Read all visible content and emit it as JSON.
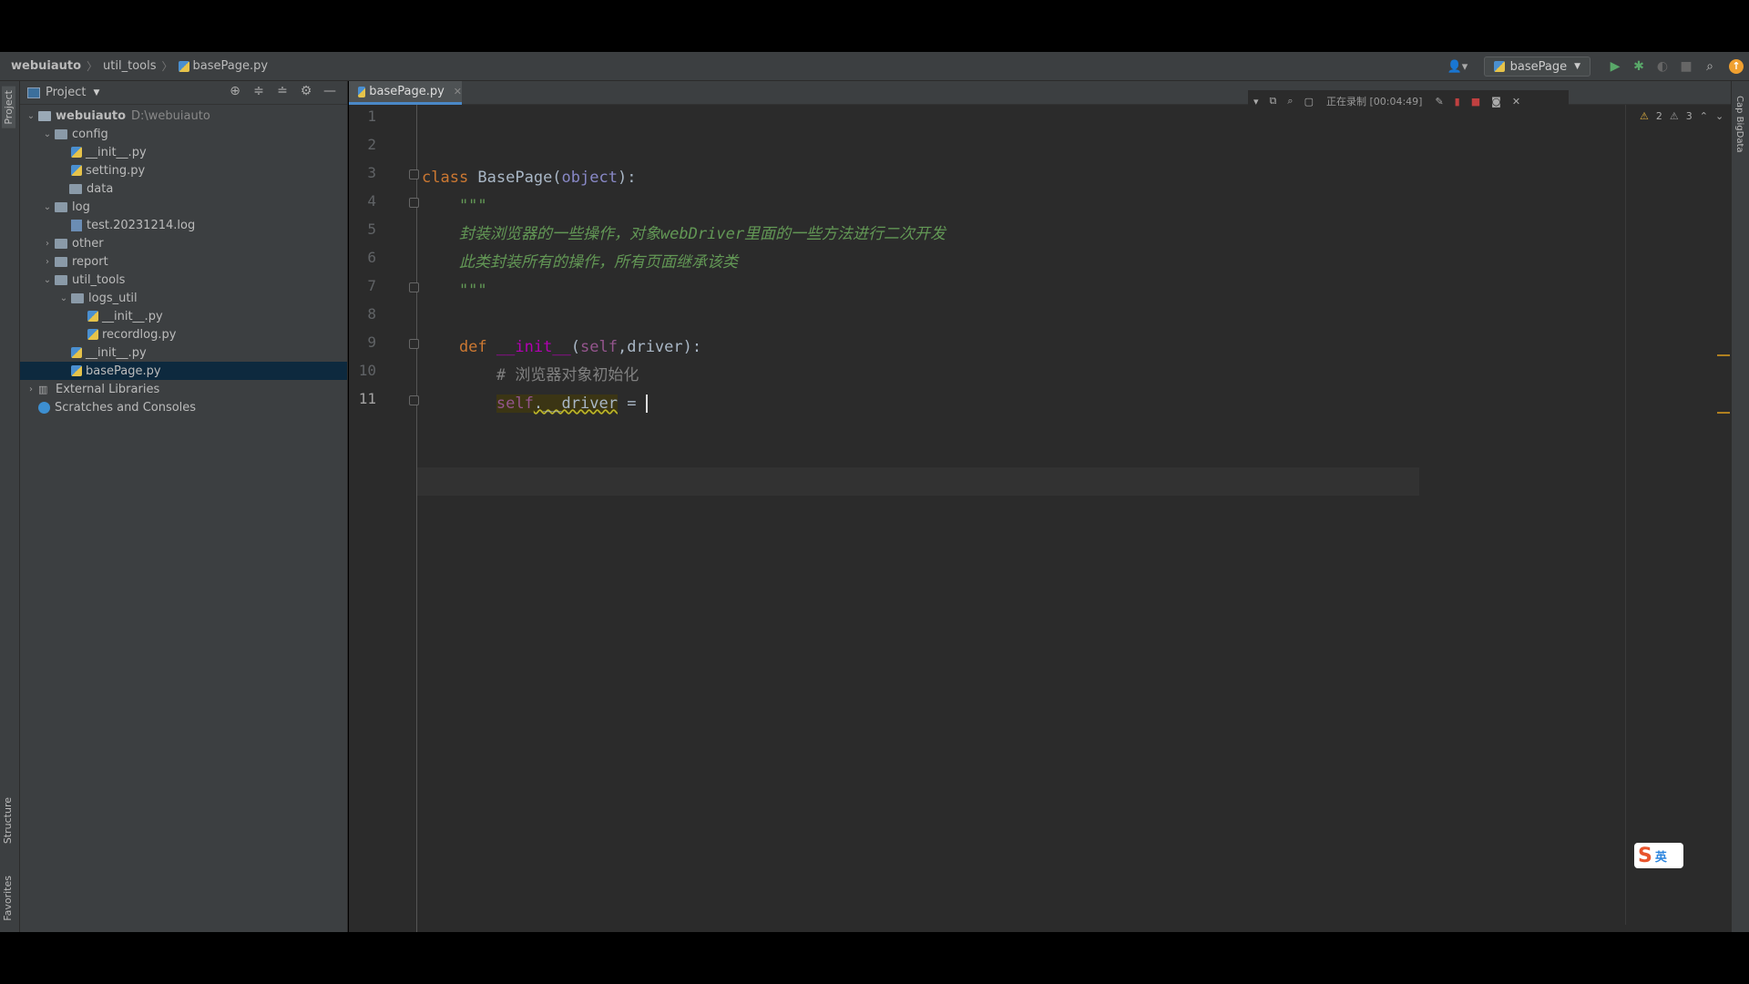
{
  "breadcrumb": {
    "project": "webuiauto",
    "folder": "util_tools",
    "file": "basePage.py"
  },
  "run_config": {
    "label": "basePage"
  },
  "project_panel": {
    "title": "Project",
    "tree": [
      {
        "label": "webuiauto",
        "path": "D:\\webuiauto",
        "kind": "root",
        "expanded": true
      },
      {
        "label": "config",
        "kind": "folder",
        "expanded": true
      },
      {
        "label": "__init__.py",
        "kind": "py"
      },
      {
        "label": "setting.py",
        "kind": "py"
      },
      {
        "label": "data",
        "kind": "folder"
      },
      {
        "label": "log",
        "kind": "folder",
        "expanded": true
      },
      {
        "label": "test.20231214.log",
        "kind": "log"
      },
      {
        "label": "other",
        "kind": "folder",
        "collapsed": true
      },
      {
        "label": "report",
        "kind": "folder",
        "collapsed": true
      },
      {
        "label": "util_tools",
        "kind": "folder",
        "expanded": true
      },
      {
        "label": "logs_util",
        "kind": "folder",
        "expanded": true
      },
      {
        "label": "__init__.py",
        "kind": "py"
      },
      {
        "label": "recordlog.py",
        "kind": "py"
      },
      {
        "label": "__init__.py",
        "kind": "py"
      },
      {
        "label": "basePage.py",
        "kind": "py",
        "selected": true
      },
      {
        "label": "External Libraries",
        "kind": "lib",
        "collapsed": true
      },
      {
        "label": "Scratches and Consoles",
        "kind": "scratch"
      }
    ]
  },
  "editor": {
    "tab_label": "basePage.py",
    "recording_text": "正在录制 [00:04:49]",
    "warnings": {
      "yellow": "2",
      "grey": "3"
    },
    "line_numbers": [
      "1",
      "2",
      "3",
      "4",
      "5",
      "6",
      "7",
      "8",
      "9",
      "10",
      "11"
    ],
    "code": {
      "l3_kw": "class",
      "l3_name": " BasePage(",
      "l3_obj": "object",
      "l3_end": "):",
      "l4": "    \"\"\"",
      "l5": "    封装浏览器的一些操作，对象webDriver里面的一些方法进行二次开发",
      "l6": "    此类封装所有的操作，所有页面继承该类",
      "l7": "    \"\"\"",
      "l9_kw": "    def",
      "l9_fn": " __init__",
      "l9_open": "(",
      "l9_self": "self",
      "l9_rest": ",driver):",
      "l10": "        # 浏览器对象初始化",
      "l11_indent": "        ",
      "l11_self": "self",
      "l11_attr": ".__driver",
      "l11_eq": " = "
    }
  },
  "side_tabs": {
    "project": "Project",
    "structure": "Structure",
    "favorites": "Favorites",
    "right": "Cap BigData"
  },
  "ime": {
    "brand": "S",
    "mode": "英"
  },
  "colors": {
    "bg": "#2b2b2b",
    "panel": "#3c3f41",
    "selection": "#0d293e",
    "keyword": "#cc7832",
    "docstring": "#629755"
  }
}
